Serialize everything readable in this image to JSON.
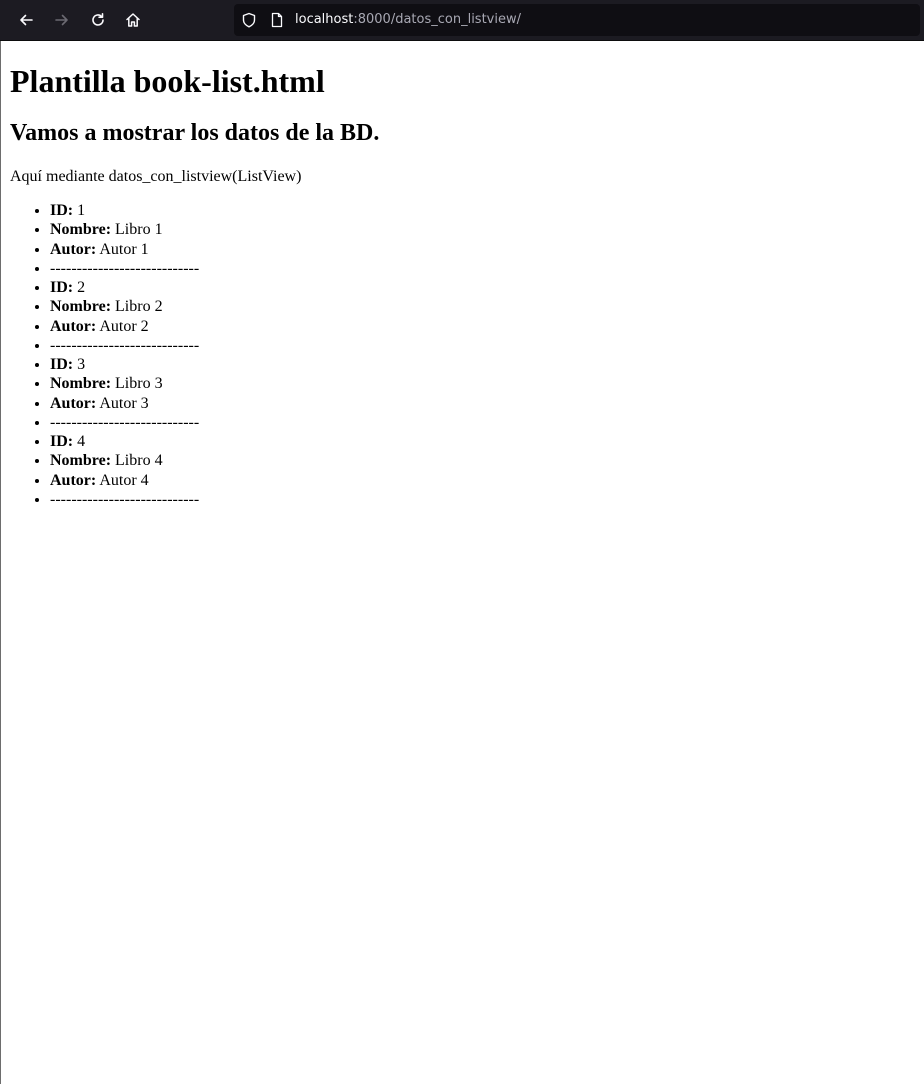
{
  "browser": {
    "url_host": "localhost",
    "url_rest": ":8000/datos_con_listview/"
  },
  "page": {
    "title": "Plantilla book-list.html",
    "subtitle": "Vamos a mostrar los datos de la BD.",
    "description": "Aquí mediante datos_con_listview(ListView)",
    "labels": {
      "id": "ID:",
      "nombre": "Nombre:",
      "autor": "Autor:"
    },
    "separator": "----------------------------",
    "books": [
      {
        "id": "1",
        "nombre": "Libro 1",
        "autor": "Autor 1"
      },
      {
        "id": "2",
        "nombre": "Libro 2",
        "autor": "Autor 2"
      },
      {
        "id": "3",
        "nombre": "Libro 3",
        "autor": "Autor 3"
      },
      {
        "id": "4",
        "nombre": "Libro 4",
        "autor": "Autor 4"
      }
    ]
  }
}
